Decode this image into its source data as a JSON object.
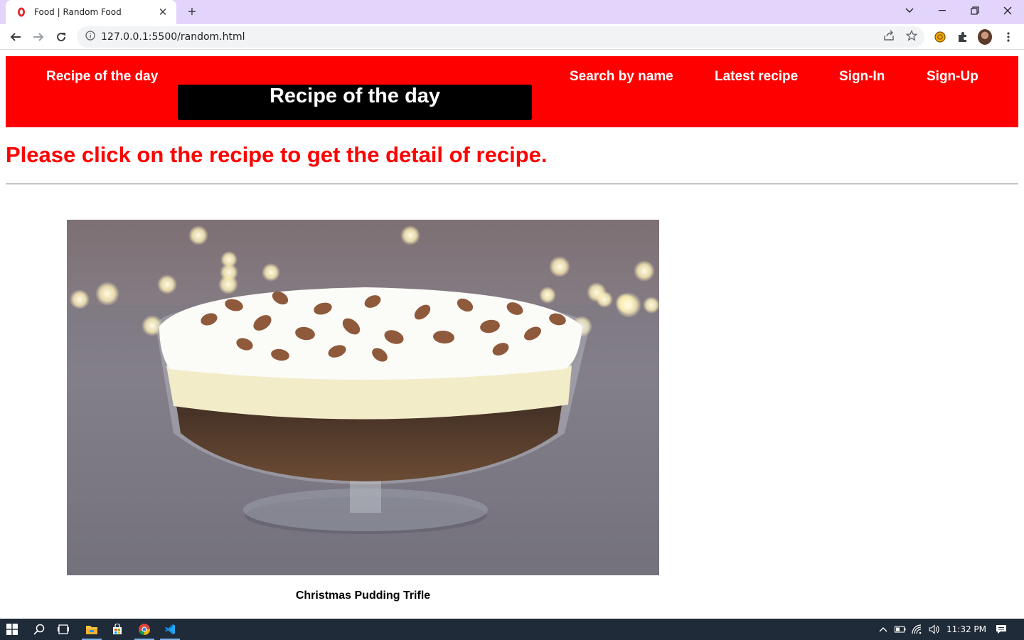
{
  "browser": {
    "tab": {
      "title": "Food | Random Food",
      "close": "✕"
    },
    "new_tab": "+",
    "window_controls": {
      "list": "⌄",
      "minimize": "–",
      "restore": "❐",
      "close": "✕"
    },
    "address": {
      "url": "127.0.0.1:5500/random.html"
    }
  },
  "page": {
    "nav": {
      "recipe_of_day": "Recipe of the day",
      "banner": "Recipe of the day",
      "search": "Search by name",
      "latest": "Latest recipe",
      "signin": "Sign-In",
      "signup": "Sign-Up"
    },
    "instruction": "Please click on the recipe to get the detail of recipe.",
    "recipe": {
      "name": "Christmas Pudding Trifle"
    }
  },
  "taskbar": {
    "time": "11:32 PM"
  },
  "colors": {
    "nav_red": "#ff0000",
    "banner_black": "#000000",
    "tab_strip": "#e3d4fb",
    "taskbar": "#1f2b38"
  }
}
